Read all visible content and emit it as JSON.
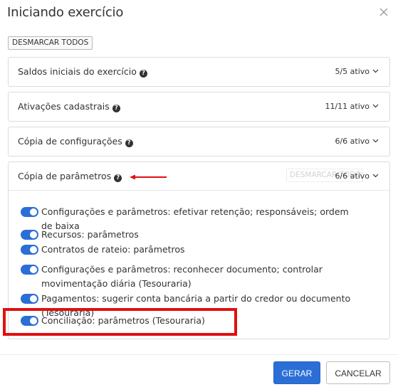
{
  "dialog": {
    "title": "Iniciando exercício",
    "close_icon": "close-icon",
    "desmarcar_todos": "DESMARCAR TODOS"
  },
  "panels": [
    {
      "label": "Saldos iniciais do exercício",
      "status": "5/5 ativo"
    },
    {
      "label": "Ativações cadastrais",
      "status": "11/11 ativo"
    },
    {
      "label": "Cópia de configurações",
      "status": "6/6 ativo"
    },
    {
      "label": "Cópia de parâmetros",
      "status": "6/6 ativo",
      "ghost_button": "DESMARCAR TODOS"
    }
  ],
  "parametros_items": [
    {
      "label": "Configurações e parâmetros: efetivar retenção; responsáveis; ordem de baixa",
      "enabled": true
    },
    {
      "label": "Recursos: parâmetros",
      "enabled": true
    },
    {
      "label": "Contratos de rateio: parâmetros",
      "enabled": true
    },
    {
      "label": "Configurações e parâmetros: reconhecer documento; controlar movimentação diária (Tesouraria)",
      "enabled": true
    },
    {
      "label": "Pagamentos: sugerir conta bancária a partir do credor ou documento (Tesouraria)",
      "enabled": true
    },
    {
      "label": "Conciliação: parâmetros (Tesouraria)",
      "enabled": true
    }
  ],
  "footer": {
    "gerar": "GERAR",
    "cancelar": "CANCELAR"
  },
  "colors": {
    "primary": "#2b6fd6",
    "annotation_red": "#e01010"
  }
}
